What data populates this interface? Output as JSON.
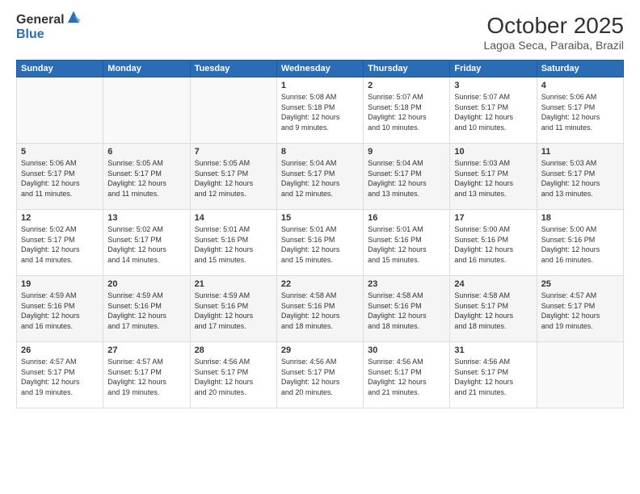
{
  "header": {
    "logo_general": "General",
    "logo_blue": "Blue",
    "title": "October 2025",
    "location": "Lagoa Seca, Paraiba, Brazil"
  },
  "weekdays": [
    "Sunday",
    "Monday",
    "Tuesday",
    "Wednesday",
    "Thursday",
    "Friday",
    "Saturday"
  ],
  "weeks": [
    [
      {
        "day": "",
        "content": ""
      },
      {
        "day": "",
        "content": ""
      },
      {
        "day": "",
        "content": ""
      },
      {
        "day": "1",
        "content": "Sunrise: 5:08 AM\nSunset: 5:18 PM\nDaylight: 12 hours\nand 9 minutes."
      },
      {
        "day": "2",
        "content": "Sunrise: 5:07 AM\nSunset: 5:18 PM\nDaylight: 12 hours\nand 10 minutes."
      },
      {
        "day": "3",
        "content": "Sunrise: 5:07 AM\nSunset: 5:17 PM\nDaylight: 12 hours\nand 10 minutes."
      },
      {
        "day": "4",
        "content": "Sunrise: 5:06 AM\nSunset: 5:17 PM\nDaylight: 12 hours\nand 11 minutes."
      }
    ],
    [
      {
        "day": "5",
        "content": "Sunrise: 5:06 AM\nSunset: 5:17 PM\nDaylight: 12 hours\nand 11 minutes."
      },
      {
        "day": "6",
        "content": "Sunrise: 5:05 AM\nSunset: 5:17 PM\nDaylight: 12 hours\nand 11 minutes."
      },
      {
        "day": "7",
        "content": "Sunrise: 5:05 AM\nSunset: 5:17 PM\nDaylight: 12 hours\nand 12 minutes."
      },
      {
        "day": "8",
        "content": "Sunrise: 5:04 AM\nSunset: 5:17 PM\nDaylight: 12 hours\nand 12 minutes."
      },
      {
        "day": "9",
        "content": "Sunrise: 5:04 AM\nSunset: 5:17 PM\nDaylight: 12 hours\nand 13 minutes."
      },
      {
        "day": "10",
        "content": "Sunrise: 5:03 AM\nSunset: 5:17 PM\nDaylight: 12 hours\nand 13 minutes."
      },
      {
        "day": "11",
        "content": "Sunrise: 5:03 AM\nSunset: 5:17 PM\nDaylight: 12 hours\nand 13 minutes."
      }
    ],
    [
      {
        "day": "12",
        "content": "Sunrise: 5:02 AM\nSunset: 5:17 PM\nDaylight: 12 hours\nand 14 minutes."
      },
      {
        "day": "13",
        "content": "Sunrise: 5:02 AM\nSunset: 5:17 PM\nDaylight: 12 hours\nand 14 minutes."
      },
      {
        "day": "14",
        "content": "Sunrise: 5:01 AM\nSunset: 5:16 PM\nDaylight: 12 hours\nand 15 minutes."
      },
      {
        "day": "15",
        "content": "Sunrise: 5:01 AM\nSunset: 5:16 PM\nDaylight: 12 hours\nand 15 minutes."
      },
      {
        "day": "16",
        "content": "Sunrise: 5:01 AM\nSunset: 5:16 PM\nDaylight: 12 hours\nand 15 minutes."
      },
      {
        "day": "17",
        "content": "Sunrise: 5:00 AM\nSunset: 5:16 PM\nDaylight: 12 hours\nand 16 minutes."
      },
      {
        "day": "18",
        "content": "Sunrise: 5:00 AM\nSunset: 5:16 PM\nDaylight: 12 hours\nand 16 minutes."
      }
    ],
    [
      {
        "day": "19",
        "content": "Sunrise: 4:59 AM\nSunset: 5:16 PM\nDaylight: 12 hours\nand 16 minutes."
      },
      {
        "day": "20",
        "content": "Sunrise: 4:59 AM\nSunset: 5:16 PM\nDaylight: 12 hours\nand 17 minutes."
      },
      {
        "day": "21",
        "content": "Sunrise: 4:59 AM\nSunset: 5:16 PM\nDaylight: 12 hours\nand 17 minutes."
      },
      {
        "day": "22",
        "content": "Sunrise: 4:58 AM\nSunset: 5:16 PM\nDaylight: 12 hours\nand 18 minutes."
      },
      {
        "day": "23",
        "content": "Sunrise: 4:58 AM\nSunset: 5:16 PM\nDaylight: 12 hours\nand 18 minutes."
      },
      {
        "day": "24",
        "content": "Sunrise: 4:58 AM\nSunset: 5:17 PM\nDaylight: 12 hours\nand 18 minutes."
      },
      {
        "day": "25",
        "content": "Sunrise: 4:57 AM\nSunset: 5:17 PM\nDaylight: 12 hours\nand 19 minutes."
      }
    ],
    [
      {
        "day": "26",
        "content": "Sunrise: 4:57 AM\nSunset: 5:17 PM\nDaylight: 12 hours\nand 19 minutes."
      },
      {
        "day": "27",
        "content": "Sunrise: 4:57 AM\nSunset: 5:17 PM\nDaylight: 12 hours\nand 19 minutes."
      },
      {
        "day": "28",
        "content": "Sunrise: 4:56 AM\nSunset: 5:17 PM\nDaylight: 12 hours\nand 20 minutes."
      },
      {
        "day": "29",
        "content": "Sunrise: 4:56 AM\nSunset: 5:17 PM\nDaylight: 12 hours\nand 20 minutes."
      },
      {
        "day": "30",
        "content": "Sunrise: 4:56 AM\nSunset: 5:17 PM\nDaylight: 12 hours\nand 21 minutes."
      },
      {
        "day": "31",
        "content": "Sunrise: 4:56 AM\nSunset: 5:17 PM\nDaylight: 12 hours\nand 21 minutes."
      },
      {
        "day": "",
        "content": ""
      }
    ]
  ]
}
